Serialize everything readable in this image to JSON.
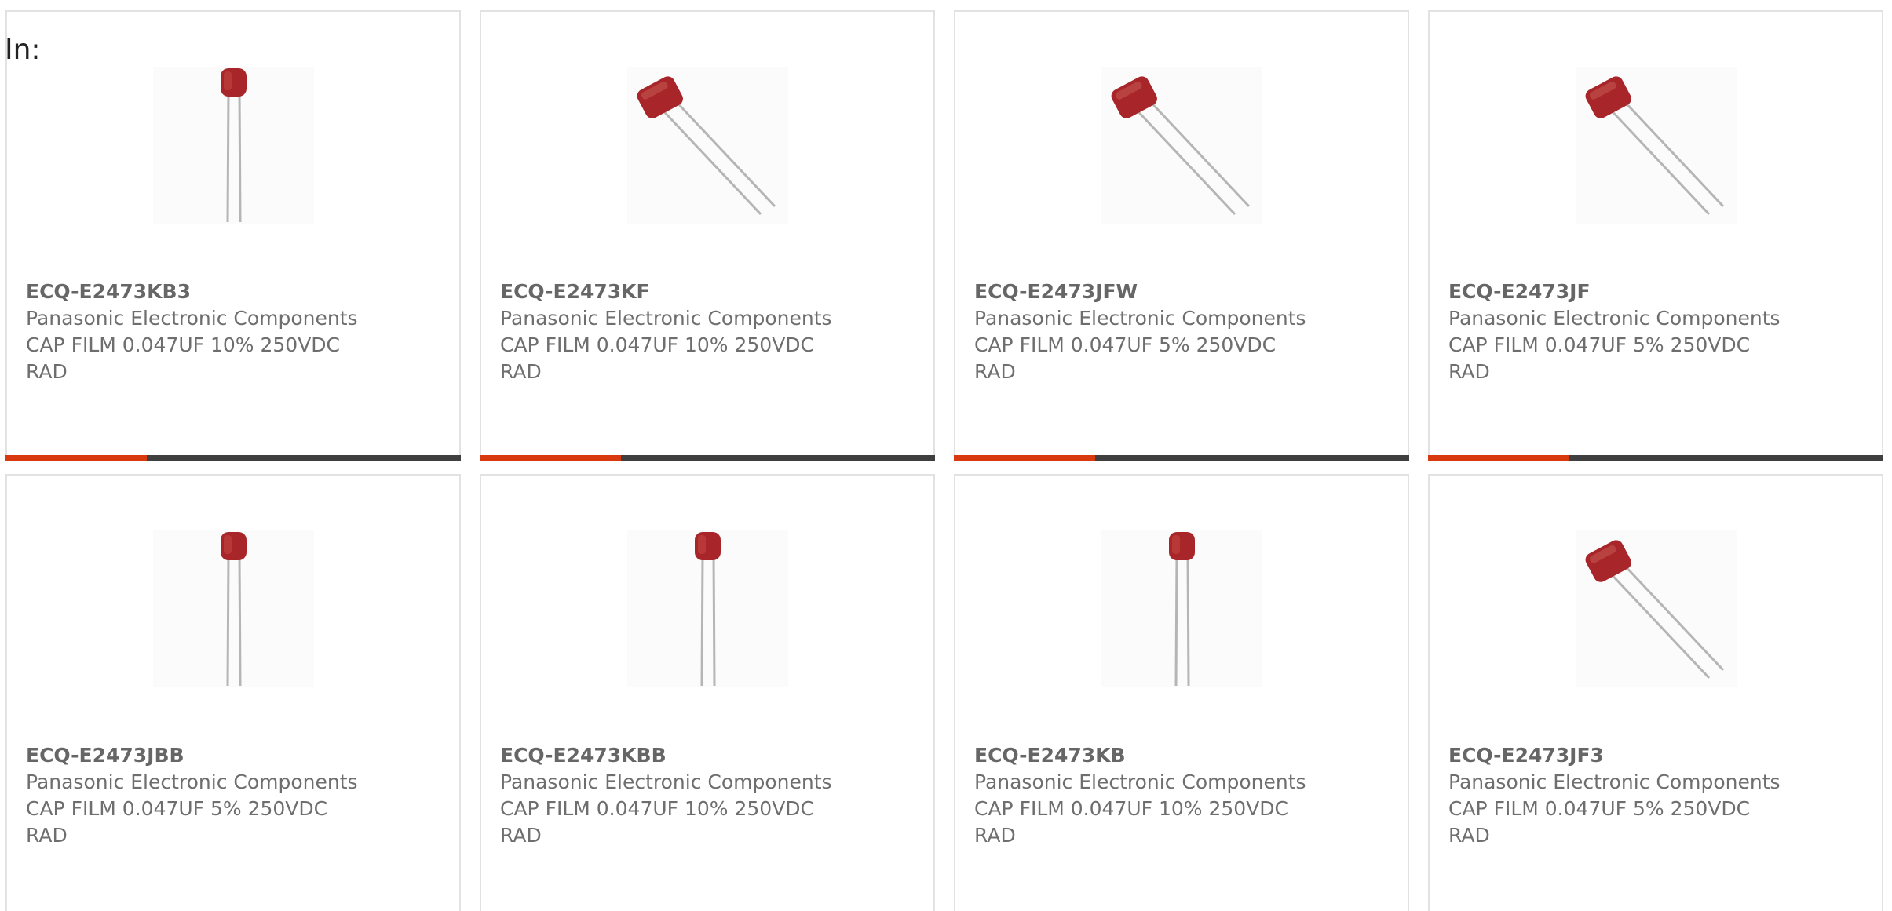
{
  "header": {
    "filter_label": "In:"
  },
  "colors": {
    "accent": "#d9390f",
    "track": "#3f3f3f",
    "capacitor_body": "#a8262a",
    "capacitor_lead": "#b5b5b5"
  },
  "products": [
    {
      "part_number": "ECQ-E2473KB3",
      "manufacturer": "Panasonic Electronic Components",
      "description": "CAP FILM 0.047UF 10% 250VDC RAD",
      "image_icon": "radial-capacitor-straight-icon",
      "progress_fraction": 0.31
    },
    {
      "part_number": "ECQ-E2473KF",
      "manufacturer": "Panasonic Electronic Components",
      "description": "CAP FILM 0.047UF 10% 250VDC RAD",
      "image_icon": "radial-capacitor-angled-icon",
      "progress_fraction": 0.31
    },
    {
      "part_number": "ECQ-E2473JFW",
      "manufacturer": "Panasonic Electronic Components",
      "description": "CAP FILM 0.047UF 5% 250VDC RAD",
      "image_icon": "radial-capacitor-angled-icon",
      "progress_fraction": 0.31
    },
    {
      "part_number": "ECQ-E2473JF",
      "manufacturer": "Panasonic Electronic Components",
      "description": "CAP FILM 0.047UF 5% 250VDC RAD",
      "image_icon": "radial-capacitor-angled-icon",
      "progress_fraction": 0.31
    },
    {
      "part_number": "ECQ-E2473JBB",
      "manufacturer": "Panasonic Electronic Components",
      "description": "CAP FILM 0.047UF 5% 250VDC RAD",
      "image_icon": "radial-capacitor-straight-icon"
    },
    {
      "part_number": "ECQ-E2473KBB",
      "manufacturer": "Panasonic Electronic Components",
      "description": "CAP FILM 0.047UF 10% 250VDC RAD",
      "image_icon": "radial-capacitor-straight-icon"
    },
    {
      "part_number": "ECQ-E2473KB",
      "manufacturer": "Panasonic Electronic Components",
      "description": "CAP FILM 0.047UF 10% 250VDC RAD",
      "image_icon": "radial-capacitor-straight-icon"
    },
    {
      "part_number": "ECQ-E2473JF3",
      "manufacturer": "Panasonic Electronic Components",
      "description": "CAP FILM 0.047UF 5% 250VDC RAD",
      "image_icon": "radial-capacitor-angled-icon"
    }
  ]
}
